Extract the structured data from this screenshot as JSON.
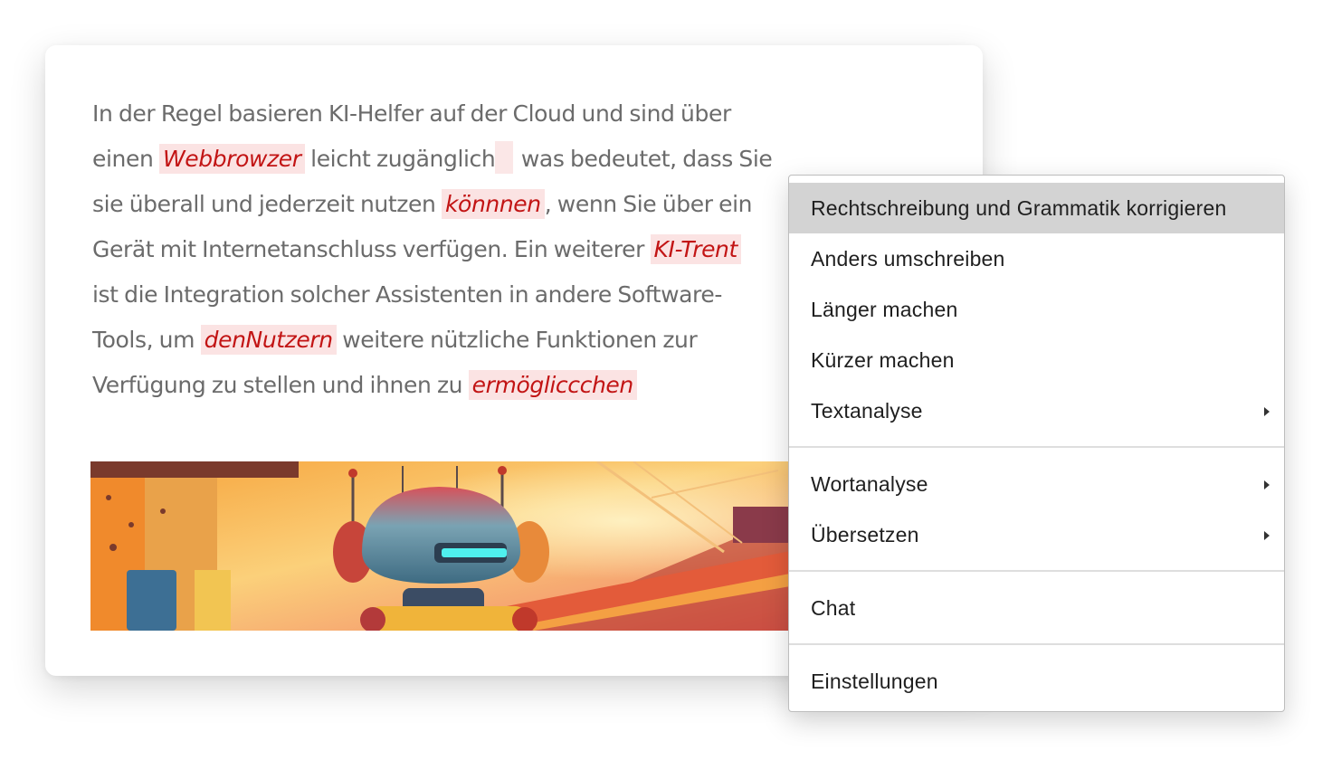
{
  "editor": {
    "line1": "In der Regel basieren KI-Helfer auf der Cloud und sind über",
    "line2_a": "einen ",
    "err_webbrowzer": "Webbrowzer",
    "line2_b": " leicht zugänglich",
    "line2_c": " was bedeutet, dass Sie",
    "line3_a": "sie überall und jederzeit nutzen ",
    "err_koennnen": "könnnen",
    "line3_b": ", wenn Sie über ein",
    "line4_a": "Gerät mit Internetanschluss verfügen. Ein weiterer ",
    "err_kitrent": "KI-Trent",
    "line5": "ist die Integration solcher Assistenten in andere Software-",
    "line6_a": "Tools, um ",
    "err_dennutzern": "denNutzern",
    "line6_b": " weitere nützliche Funktionen zur",
    "line7_a": "Verfügung zu stellen und ihnen zu ",
    "err_ermoeglicchen": "ermögliccchen"
  },
  "banner": {
    "icon": "robot-illustration"
  },
  "menu": {
    "correct": "Rechtschreibung und Grammatik korrigieren",
    "rewrite": "Anders umschreiben",
    "longer": "Länger machen",
    "shorter": "Kürzer machen",
    "text_analysis": "Textanalyse",
    "word_analysis": "Wortanalyse",
    "translate": "Übersetzen",
    "chat": "Chat",
    "settings": "Einstellungen"
  },
  "colors": {
    "error_text": "#c21414",
    "error_bg": "#fbe3e3",
    "menu_hover": "#d3d3d3"
  }
}
